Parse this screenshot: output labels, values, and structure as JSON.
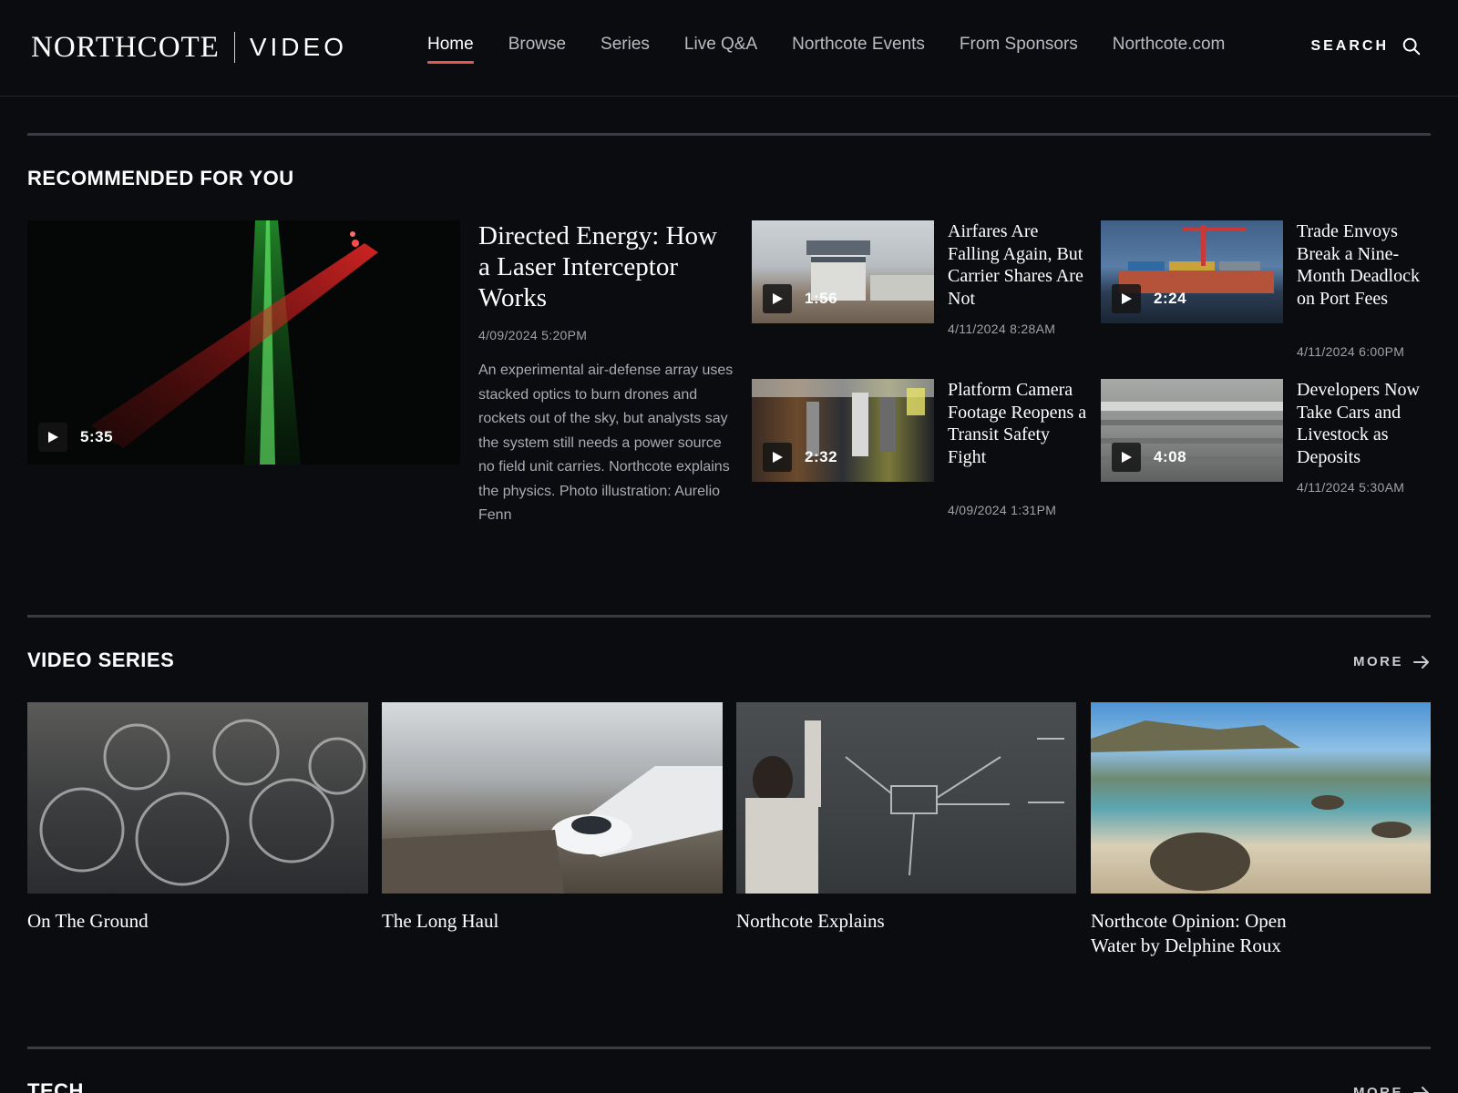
{
  "header": {
    "brand": "NORTHCOTE",
    "section": "VIDEO",
    "nav": [
      {
        "label": "Home",
        "active": true
      },
      {
        "label": "Browse"
      },
      {
        "label": "Series"
      },
      {
        "label": "Live Q&A"
      },
      {
        "label": "Northcote Events"
      },
      {
        "label": "From Sponsors"
      },
      {
        "label": "Northcote.com"
      }
    ],
    "search_label": "SEARCH"
  },
  "recommended": {
    "title": "RECOMMENDED FOR YOU",
    "feature": {
      "headline": "Directed Energy: How a Laser Interceptor Works",
      "timestamp": "4/09/2024 5:20PM",
      "duration": "5:35",
      "summary": "An experimental air-defense array uses stacked optics to burn drones and rockets out of the sky, but analysts say the system still needs a power source no field unit carries. Northcote explains the physics. Photo illustration: Aurelio Fenn"
    },
    "items": [
      {
        "headline": "Airfares Are Falling Again, But Carrier Shares Are Not",
        "timestamp": "4/11/2024 8:28AM",
        "duration": "1:56"
      },
      {
        "headline": "Trade Envoys Break a Nine-Month Deadlock on Port Fees",
        "timestamp": "4/11/2024 6:00PM",
        "duration": "2:24"
      },
      {
        "headline": "Platform Camera Footage Reopens a Transit Safety Fight",
        "timestamp": "4/09/2024 1:31PM",
        "duration": "2:32"
      },
      {
        "headline": "Developers Now Take Cars and Livestock as Deposits",
        "timestamp": "4/11/2024 5:30AM",
        "duration": "4:08"
      }
    ]
  },
  "series": {
    "title": "VIDEO SERIES",
    "more_label": "MORE",
    "items": [
      {
        "title": "On The Ground"
      },
      {
        "title": "The Long Haul"
      },
      {
        "title": "Northcote Explains"
      },
      {
        "title": "Northcote Opinion: Open Water by Delphine Roux"
      }
    ]
  },
  "tech": {
    "title": "TECH",
    "more_label": "MORE"
  },
  "colors": {
    "background": "#0b0c0f",
    "accent": "#e0584f",
    "muted_text": "#9ea2a8"
  }
}
